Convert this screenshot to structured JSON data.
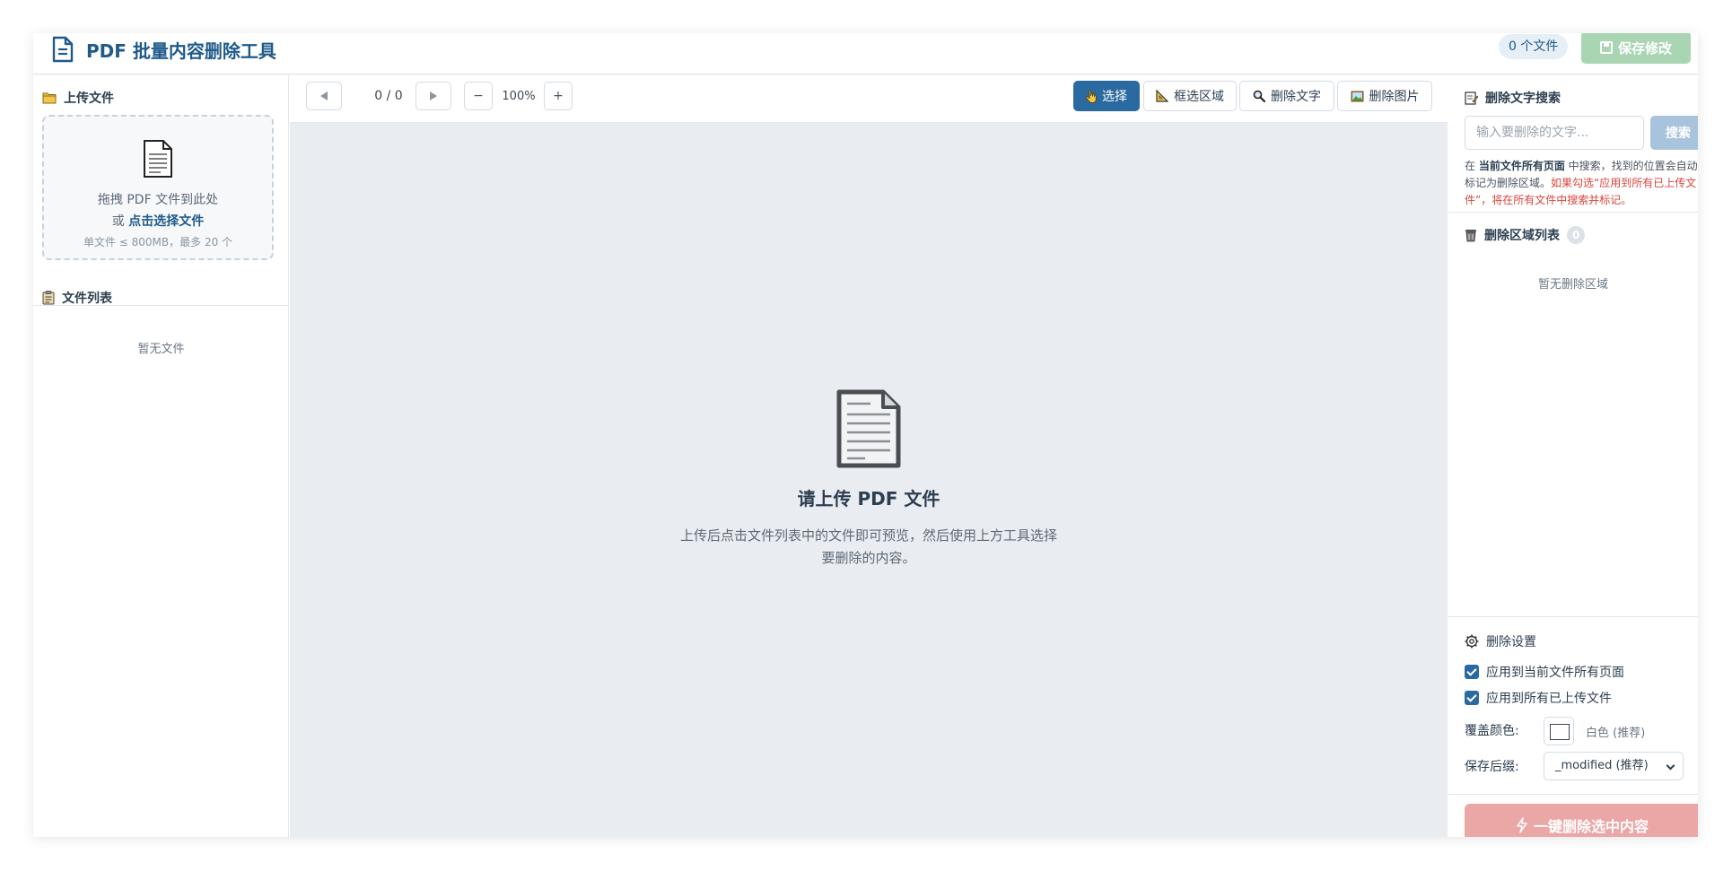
{
  "header": {
    "title": "PDF 批量内容删除工具",
    "file_count": "0 个文件",
    "save_label": "保存修改"
  },
  "left": {
    "upload_title": "上传文件",
    "dropzone": {
      "line1": "拖拽 PDF 文件到此处",
      "line2_prefix": "或 ",
      "line2_link": "点击选择文件",
      "limits": "单文件 ≤ 800MB，最多 20 个"
    },
    "filelist_title": "文件列表",
    "filelist_empty": "暂无文件"
  },
  "toolbar": {
    "page_indicator": "0 / 0",
    "zoom": "100%",
    "zoom_out": "−",
    "zoom_in": "+",
    "tools": {
      "select": "选择",
      "box": "框选区域",
      "delete_text": "删除文字",
      "delete_image": "删除图片"
    }
  },
  "viewer": {
    "empty_title": "请上传 PDF 文件",
    "empty_desc": "上传后点击文件列表中的文件即可预览，然后使用上方工具选择要删除的内容。"
  },
  "right": {
    "search_title": "删除文字搜索",
    "search_placeholder": "输入要删除的文字...",
    "search_button": "搜索",
    "hint": {
      "pre": "在 ",
      "bold": "当前文件所有页面",
      "mid": " 中搜索，找到的位置会自动标记为删除区域。",
      "red": "如果勾选“应用到所有已上传文件”，将在所有文件中搜索并标记。"
    },
    "list_title": "删除区域列表",
    "list_count": "0",
    "list_empty": "暂无删除区域",
    "settings_title": "删除设置",
    "apply_all_pages": "应用到当前文件所有页面",
    "apply_all_files": "应用到所有已上传文件",
    "cover_color_label": "覆盖颜色:",
    "cover_color_value": "白色 (推荐)",
    "suffix_label": "保存后缀:",
    "suffix_value": "_modified (推荐)",
    "delete_button": "一键删除选中内容"
  },
  "colors": {
    "brand": "#1f5a8a",
    "accent": "#2a6aa1",
    "save_disabled": "#a9d5b3",
    "danger_disabled": "#eba6a6",
    "hint_red": "#d9443b"
  },
  "icons": {
    "brand": "document-icon",
    "upload": "folder-icon",
    "filelist": "clipboard-icon",
    "search_title": "memo-icon",
    "list_title": "trash-icon",
    "settings_title": "gear-icon",
    "delete_button": "lightning-icon"
  }
}
